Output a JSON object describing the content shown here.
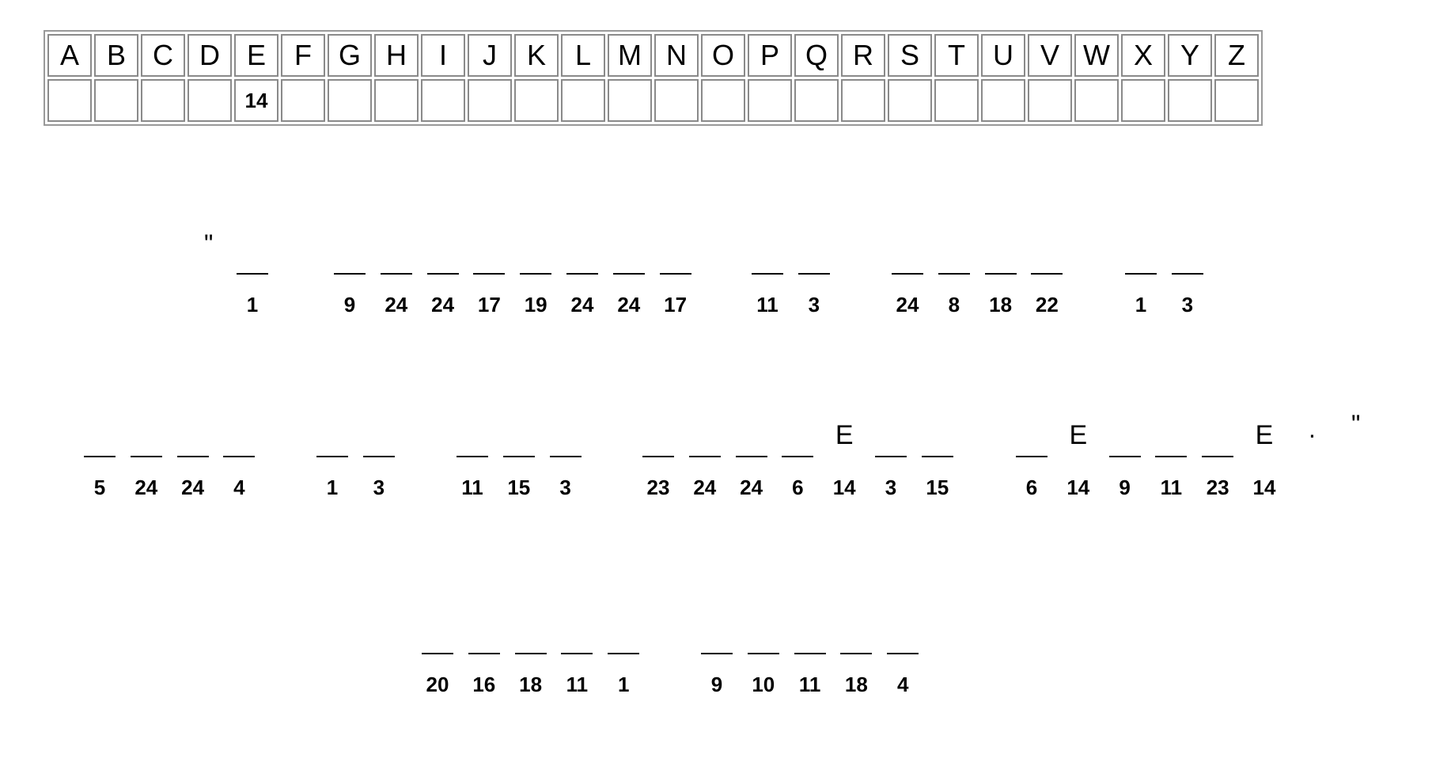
{
  "key": {
    "letters": [
      "A",
      "B",
      "C",
      "D",
      "E",
      "F",
      "G",
      "H",
      "I",
      "J",
      "K",
      "L",
      "M",
      "N",
      "O",
      "P",
      "Q",
      "R",
      "S",
      "T",
      "U",
      "V",
      "W",
      "X",
      "Y",
      "Z"
    ],
    "answers": [
      "",
      "",
      "",
      "",
      "14",
      "",
      "",
      "",
      "",
      "",
      "",
      "",
      "",
      "",
      "",
      "",
      "",
      "",
      "",
      "",
      "",
      "",
      "",
      "",
      "",
      ""
    ]
  },
  "puzzle": {
    "open_quote": "\"",
    "end_period": ".",
    "close_quote": "\"",
    "lines": [
      {
        "words": [
          {
            "nums": [
              "1"
            ],
            "letters": [
              ""
            ]
          },
          {
            "nums": [
              "9",
              "24",
              "24",
              "17",
              "19",
              "24",
              "24",
              "17"
            ],
            "letters": [
              "",
              "",
              "",
              "",
              "",
              "",
              "",
              ""
            ]
          },
          {
            "nums": [
              "11",
              "3"
            ],
            "letters": [
              "",
              ""
            ]
          },
          {
            "nums": [
              "24",
              "8",
              "18",
              "22"
            ],
            "letters": [
              "",
              "",
              "",
              ""
            ]
          },
          {
            "nums": [
              "1",
              "3"
            ],
            "letters": [
              "",
              ""
            ]
          }
        ]
      },
      {
        "words": [
          {
            "nums": [
              "5",
              "24",
              "24",
              "4"
            ],
            "letters": [
              "",
              "",
              "",
              ""
            ]
          },
          {
            "nums": [
              "1",
              "3"
            ],
            "letters": [
              "",
              ""
            ]
          },
          {
            "nums": [
              "11",
              "15",
              "3"
            ],
            "letters": [
              "",
              "",
              ""
            ]
          },
          {
            "nums": [
              "23",
              "24",
              "24",
              "6",
              "14",
              "3",
              "15"
            ],
            "letters": [
              "",
              "",
              "",
              "",
              "E",
              "",
              ""
            ]
          },
          {
            "nums": [
              "6",
              "14",
              "9",
              "11",
              "23",
              "14"
            ],
            "letters": [
              "",
              "E",
              "",
              "",
              "",
              "E"
            ]
          }
        ]
      },
      {
        "words": [
          {
            "nums": [
              "20",
              "16",
              "18",
              "11",
              "1"
            ],
            "letters": [
              "",
              "",
              "",
              "",
              ""
            ]
          },
          {
            "nums": [
              "9",
              "10",
              "11",
              "18",
              "4"
            ],
            "letters": [
              "",
              "",
              "",
              "",
              ""
            ]
          }
        ]
      }
    ]
  }
}
